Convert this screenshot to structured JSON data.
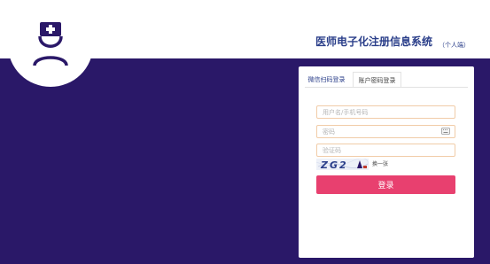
{
  "header": {
    "title": "医师电子化注册信息系统",
    "subtitle": "（个人端）",
    "logo_icon": "doctor-nurse-cap-icon"
  },
  "login": {
    "tabs": [
      {
        "label": "微信扫码登录",
        "active": false
      },
      {
        "label": "账户密码登录",
        "active": true
      }
    ],
    "username_placeholder": "用户名/手机号码",
    "password_placeholder": "密码",
    "captcha_placeholder": "验证码",
    "captcha_text": "ZG2",
    "refresh_label": "换一张",
    "submit_label": "登录",
    "keyboard_icon": "keyboard-icon"
  },
  "colors": {
    "background": "#2a1868",
    "accent": "#e8406f",
    "title": "#2b3f8a"
  }
}
